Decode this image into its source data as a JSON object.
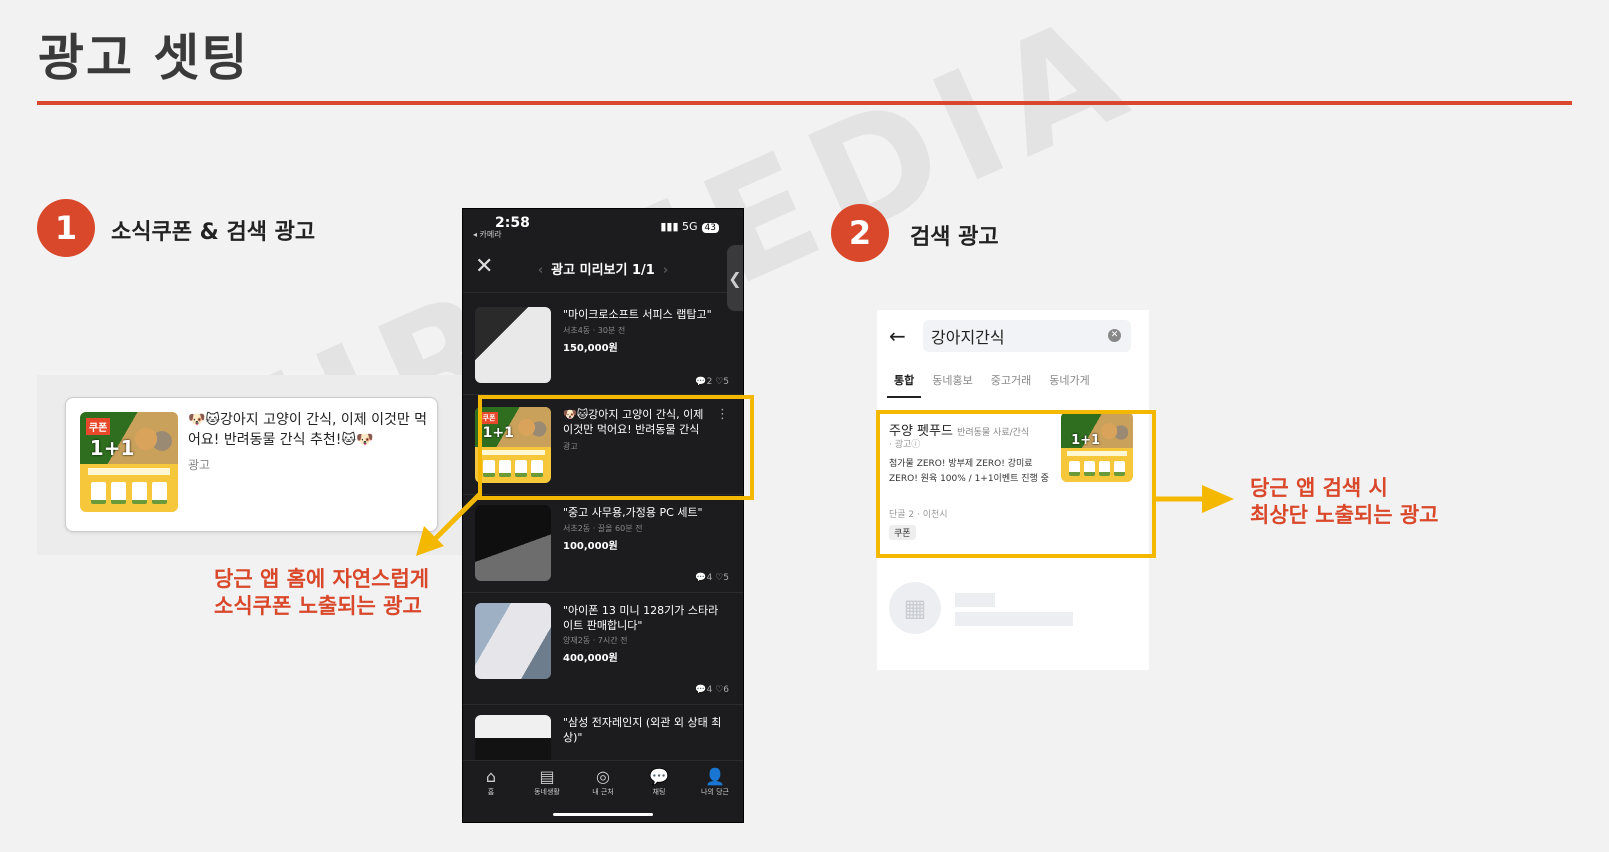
{
  "header": {
    "title": "광고 셋팅"
  },
  "step1": {
    "number": "1",
    "label": "소식쿠폰 & 검색 광고"
  },
  "step2": {
    "number": "2",
    "label": "검색 광고"
  },
  "watermark": "PURIMEDIA",
  "ad_card": {
    "coupon_badge": "쿠폰",
    "promo": "1+1",
    "title": "🐶🐱강아지 고양이 간식, 이제 이것만 먹어요! 반려동물 간식 추천!🐱🐶",
    "tag": "광고"
  },
  "callout_left": {
    "line1": "당근 앱 홈에 자연스럽게",
    "line2": "소식쿠폰 노출되는 광고"
  },
  "callout_right": {
    "line1": "당근 앱 검색 시",
    "line2": "최상단 노출되는 광고"
  },
  "phone": {
    "status": {
      "time": "2:58",
      "back": "◂ 카메라",
      "signal": "5G",
      "battery": "43"
    },
    "nav_title": "광고 미리보기 1/1",
    "listings": [
      {
        "title": "\"마이크로소프트 서피스 랩탑고\"",
        "meta": "서초4동 · 30분 전",
        "price": "150,000원",
        "counts": "💬2 ♡5"
      },
      {
        "title": "🐶🐱강아지 고양이 간식, 이제 이것만 먹어요! 반려동물 간식 ...",
        "meta": "광고",
        "price": "",
        "counts": "⋮"
      },
      {
        "title": "\"중고 사무용,가정용 PC 세트\"",
        "meta": "서초2동 · 끌올 60분 전",
        "price": "100,000원",
        "counts": "💬4 ♡5"
      },
      {
        "title": "\"아이폰 13 미니 128기가 스타라이트 판매합니다\"",
        "meta": "양재2동 · 7시간 전",
        "price": "400,000원",
        "counts": "💬4 ♡6"
      },
      {
        "title": "\"삼성 전자레인지 (외관 외 상태 최상)\"",
        "meta": "",
        "price": "",
        "counts": ""
      }
    ],
    "tabs": [
      {
        "icon": "⌂",
        "label": "홈"
      },
      {
        "icon": "▤",
        "label": "동네생활"
      },
      {
        "icon": "◎",
        "label": "내 근처"
      },
      {
        "icon": "💬",
        "label": "채팅"
      },
      {
        "icon": "👤",
        "label": "나의 당근"
      }
    ]
  },
  "search": {
    "query": "강아지간식",
    "tabs": [
      "통합",
      "동네홍보",
      "중고거래",
      "동네가게"
    ],
    "result": {
      "shop": "주양 펫푸드",
      "category": "반려동물 사료/간식",
      "ad": "· 광고ⓘ",
      "desc": "첨가물 ZERO! 방부제 ZERO! 강미료 ZERO! 원육 100% / 1+1이벤트 진행 중",
      "meta": "단골 2 · 이천시",
      "coupon": "쿠폰"
    }
  },
  "colors": {
    "accent": "#d9482b",
    "highlight": "#f5b800"
  }
}
